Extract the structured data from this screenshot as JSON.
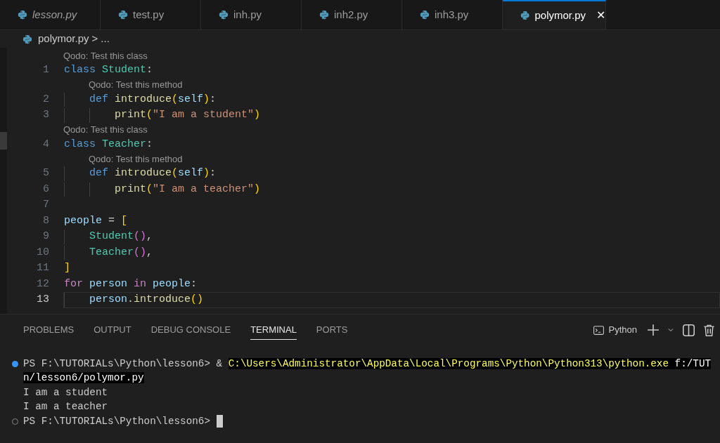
{
  "tabs": [
    {
      "label": "lesson.py",
      "selected": false,
      "italic": true
    },
    {
      "label": "test.py",
      "selected": false,
      "italic": false
    },
    {
      "label": "inh.py",
      "selected": false,
      "italic": false
    },
    {
      "label": "inh2.py",
      "selected": false,
      "italic": false
    },
    {
      "label": "inh3.py",
      "selected": false,
      "italic": false
    },
    {
      "label": "polymor.py",
      "selected": true,
      "italic": false,
      "close": "✕"
    }
  ],
  "breadcrumb": {
    "file": "polymor.py",
    "separator": ">",
    "rest": "..."
  },
  "code_lines": [
    {
      "lens": "Qodo: Test this class",
      "number": "1",
      "current": false,
      "tokens": [
        {
          "t": "class ",
          "kind": "keyword"
        },
        {
          "t": "Student",
          "kind": "type"
        },
        {
          "t": ":",
          "kind": "plain"
        }
      ]
    },
    {
      "lens": "Qodo: Test this method",
      "number": "2",
      "current": false,
      "tokens": [
        {
          "kind": "indent"
        },
        {
          "t": "def ",
          "kind": "keyword"
        },
        {
          "t": "introduce",
          "kind": "function"
        },
        {
          "t": "(",
          "kind": "bracket1"
        },
        {
          "t": "self",
          "kind": "variable"
        },
        {
          "t": ")",
          "kind": "bracket1"
        },
        {
          "t": ":",
          "kind": "plain"
        }
      ]
    },
    {
      "number": "3",
      "current": false,
      "tokens": [
        {
          "kind": "indent"
        },
        {
          "kind": "indent"
        },
        {
          "t": "print",
          "kind": "function"
        },
        {
          "t": "(",
          "kind": "bracket1"
        },
        {
          "t": "\"I am a student\"",
          "kind": "string"
        },
        {
          "t": ")",
          "kind": "bracket1"
        }
      ]
    },
    {
      "lens": "Qodo: Test this class",
      "number": "4",
      "current": false,
      "tokens": [
        {
          "t": "class ",
          "kind": "keyword"
        },
        {
          "t": "Teacher",
          "kind": "type"
        },
        {
          "t": ":",
          "kind": "plain"
        }
      ]
    },
    {
      "lens": "Qodo: Test this method",
      "number": "5",
      "current": false,
      "tokens": [
        {
          "kind": "indent"
        },
        {
          "t": "def ",
          "kind": "keyword"
        },
        {
          "t": "introduce",
          "kind": "function"
        },
        {
          "t": "(",
          "kind": "bracket1"
        },
        {
          "t": "self",
          "kind": "variable"
        },
        {
          "t": ")",
          "kind": "bracket1"
        },
        {
          "t": ":",
          "kind": "plain"
        }
      ]
    },
    {
      "number": "6",
      "current": false,
      "tokens": [
        {
          "kind": "indent"
        },
        {
          "kind": "indent"
        },
        {
          "t": "print",
          "kind": "function"
        },
        {
          "t": "(",
          "kind": "bracket1"
        },
        {
          "t": "\"I am a teacher\"",
          "kind": "string"
        },
        {
          "t": ")",
          "kind": "bracket1"
        }
      ]
    },
    {
      "number": "7",
      "current": false
    },
    {
      "number": "8",
      "current": false,
      "tokens": [
        {
          "t": "people",
          "kind": "variable"
        },
        {
          "t": " = ",
          "kind": "plain"
        },
        {
          "t": "[",
          "kind": "bracket1"
        }
      ]
    },
    {
      "number": "9",
      "current": false,
      "tokens": [
        {
          "kind": "indent"
        },
        {
          "t": "Student",
          "kind": "type"
        },
        {
          "t": "()",
          "kind": "bracket2"
        },
        {
          "t": ",",
          "kind": "plain"
        }
      ]
    },
    {
      "number": "10",
      "current": false,
      "tokens": [
        {
          "kind": "indent"
        },
        {
          "t": "Teacher",
          "kind": "type"
        },
        {
          "t": "()",
          "kind": "bracket2"
        },
        {
          "t": ",",
          "kind": "plain"
        }
      ]
    },
    {
      "number": "11",
      "current": false,
      "tokens": [
        {
          "t": "]",
          "kind": "bracket1"
        }
      ]
    },
    {
      "number": "12",
      "current": false,
      "tokens": [
        {
          "t": "for ",
          "kind": "control"
        },
        {
          "t": "person ",
          "kind": "variable"
        },
        {
          "t": "in ",
          "kind": "control"
        },
        {
          "t": "people",
          "kind": "variable"
        },
        {
          "t": ":",
          "kind": "plain"
        }
      ]
    },
    {
      "number": "13",
      "current": true,
      "tokens": [
        {
          "kind": "indent"
        },
        {
          "t": "person",
          "kind": "variable"
        },
        {
          "t": ".",
          "kind": "plain"
        },
        {
          "t": "introduce",
          "kind": "function"
        },
        {
          "t": "()",
          "kind": "bracket1"
        }
      ]
    }
  ],
  "panel_tabs": [
    {
      "label": "PROBLEMS",
      "selected": false
    },
    {
      "label": "OUTPUT",
      "selected": false
    },
    {
      "label": "DEBUG CONSOLE",
      "selected": false
    },
    {
      "label": "TERMINAL",
      "selected": true
    },
    {
      "label": "PORTS",
      "selected": false
    }
  ],
  "panel_actions": {
    "terminal_name": "Python"
  },
  "terminal_lines": [
    {
      "kind": "command",
      "segments": [
        {
          "t": "PS F:\\TUTORIALs\\Python\\lesson6> & ",
          "kind": "plain"
        },
        {
          "t": "C:\\Users\\Administrator\\AppData\\Local\\Programs\\Python\\Python313\\python.exe",
          "kind": "highlight_yellow"
        },
        {
          "t": " f:/TUT",
          "kind": "highlight"
        }
      ]
    },
    {
      "kind": "output",
      "segments": [
        {
          "t": "n/lesson6/polymor.py",
          "kind": "highlight"
        }
      ]
    },
    {
      "kind": "output",
      "segments": [
        {
          "t": "I am a student",
          "kind": "plain"
        }
      ]
    },
    {
      "kind": "output",
      "segments": [
        {
          "t": "I am a teacher",
          "kind": "plain"
        }
      ]
    },
    {
      "kind": "prompt",
      "cursor": true,
      "segments": [
        {
          "t": "PS F:\\TUTORIALs\\Python\\lesson6> ",
          "kind": "plain"
        }
      ]
    }
  ]
}
